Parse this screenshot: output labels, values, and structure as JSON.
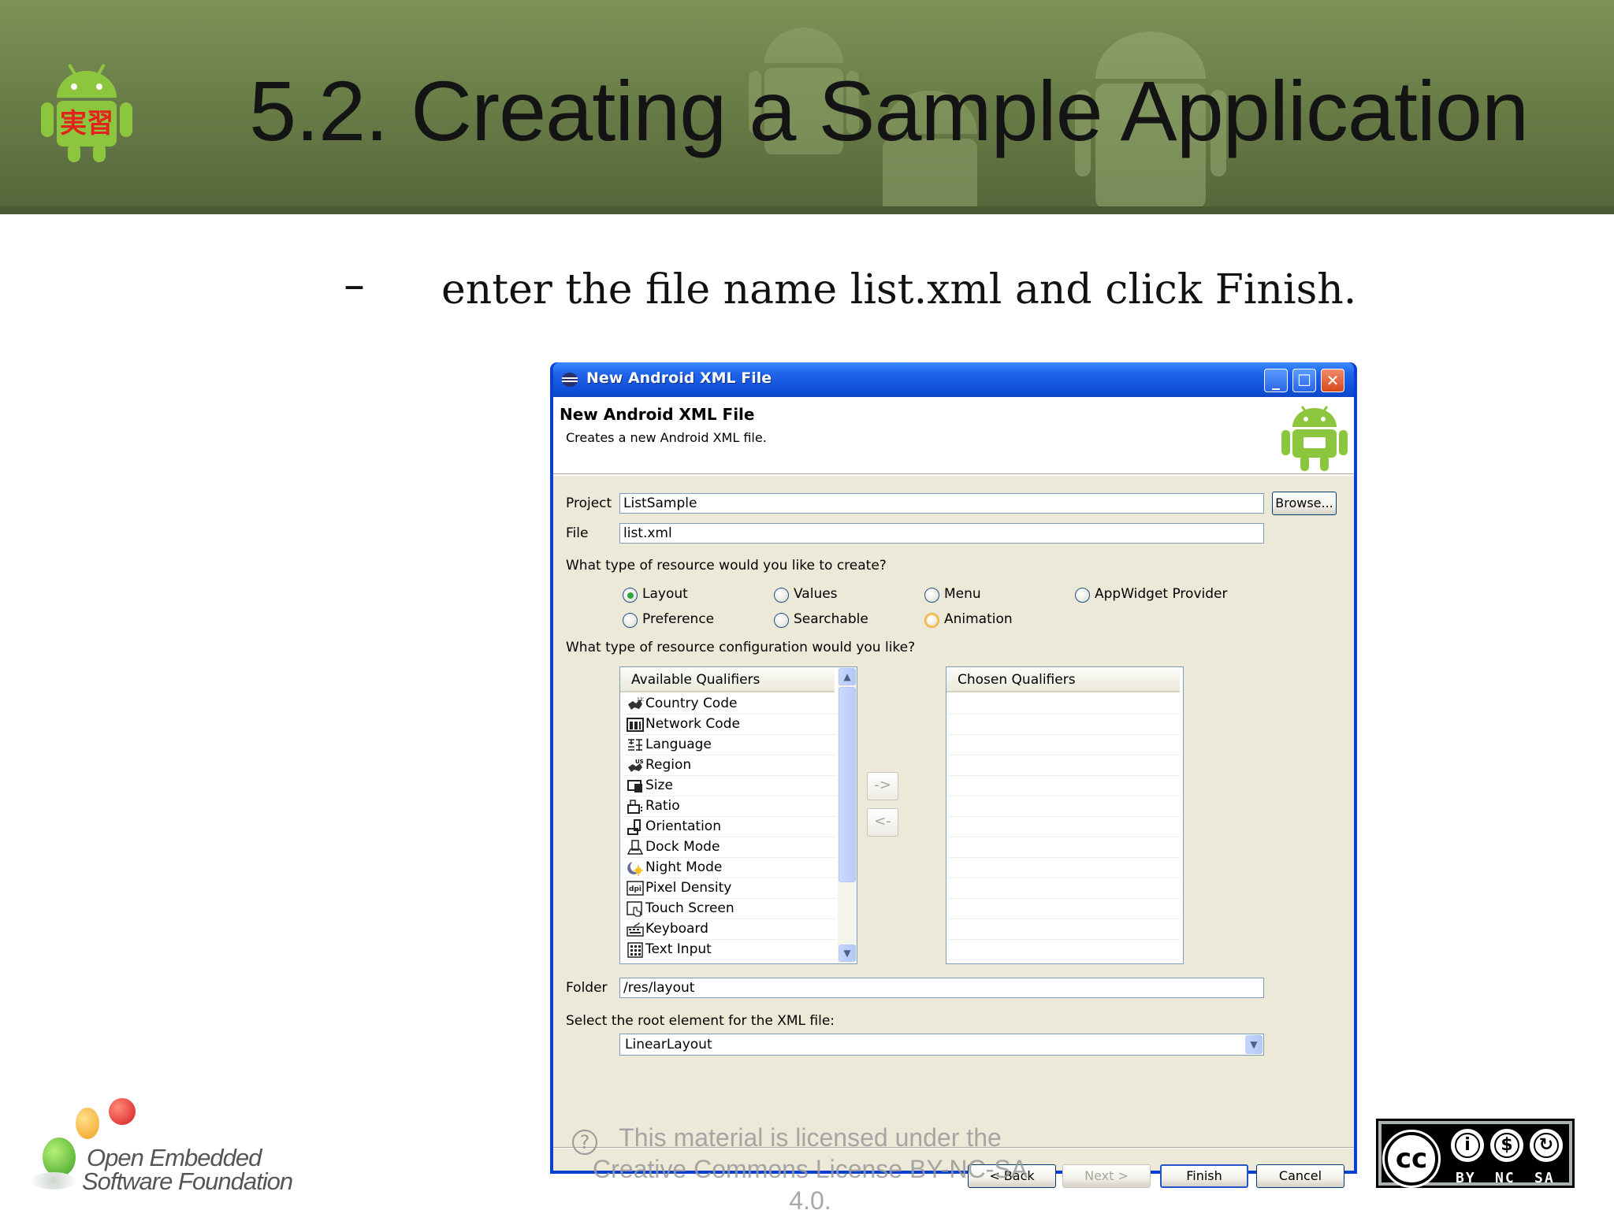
{
  "slide": {
    "title": "5.2. Creating a Sample Application",
    "logo_text": "実習",
    "bullet_dash": "–",
    "bullet": "enter the file name list.xml and click Finish."
  },
  "dialog": {
    "window_title": "New Android XML File",
    "banner_title": "New Android XML File",
    "banner_description": "Creates a new Android XML file.",
    "project_label": "Project",
    "project_value": "ListSample",
    "browse_label": "Browse...",
    "file_label": "File",
    "file_value": "list.xml",
    "resource_question": "What type of resource would you like to create?",
    "resource_types": [
      {
        "label": "Layout",
        "selected": true
      },
      {
        "label": "Values",
        "selected": false
      },
      {
        "label": "Menu",
        "selected": false
      },
      {
        "label": "AppWidget Provider",
        "selected": false
      },
      {
        "label": "Preference",
        "selected": false
      },
      {
        "label": "Searchable",
        "selected": false
      },
      {
        "label": "Animation",
        "selected": false
      }
    ],
    "config_question": "What type of resource configuration would you like?",
    "available_header": "Available Qualifiers",
    "available_qualifiers": [
      {
        "label": "Country Code",
        "icon": "country-code-icon"
      },
      {
        "label": "Network Code",
        "icon": "network-code-icon"
      },
      {
        "label": "Language",
        "icon": "language-icon"
      },
      {
        "label": "Region",
        "icon": "region-icon"
      },
      {
        "label": "Size",
        "icon": "size-icon"
      },
      {
        "label": "Ratio",
        "icon": "ratio-icon"
      },
      {
        "label": "Orientation",
        "icon": "orientation-icon"
      },
      {
        "label": "Dock Mode",
        "icon": "dock-mode-icon"
      },
      {
        "label": "Night Mode",
        "icon": "night-mode-icon"
      },
      {
        "label": "Pixel Density",
        "icon": "pixel-density-icon"
      },
      {
        "label": "Touch Screen",
        "icon": "touch-screen-icon"
      },
      {
        "label": "Keyboard",
        "icon": "keyboard-icon"
      },
      {
        "label": "Text Input",
        "icon": "text-input-icon"
      }
    ],
    "add_arrow": "->",
    "remove_arrow": "<-",
    "chosen_header": "Chosen Qualifiers",
    "folder_label": "Folder",
    "folder_value": "/res/layout",
    "root_question": "Select the root element for the XML file:",
    "root_value": "LinearLayout",
    "back_label": "< Back",
    "next_label": "Next >",
    "finish_label": "Finish",
    "cancel_label": "Cancel"
  },
  "license_text": "This material is licensed under the Creative Commons License BY-NC-SA 4.0.",
  "oesf": {
    "line1": "Open Embedded",
    "line2": "Software Foundation"
  },
  "cc_badge": {
    "main": "cc",
    "by": "BY",
    "nc": "NC",
    "sa": "SA"
  },
  "colors": {
    "header_green": "#6a7e48",
    "android_green": "#8cc63f",
    "xp_title_blue": "#0f4fd8",
    "dialog_face": "#ece9d8"
  }
}
